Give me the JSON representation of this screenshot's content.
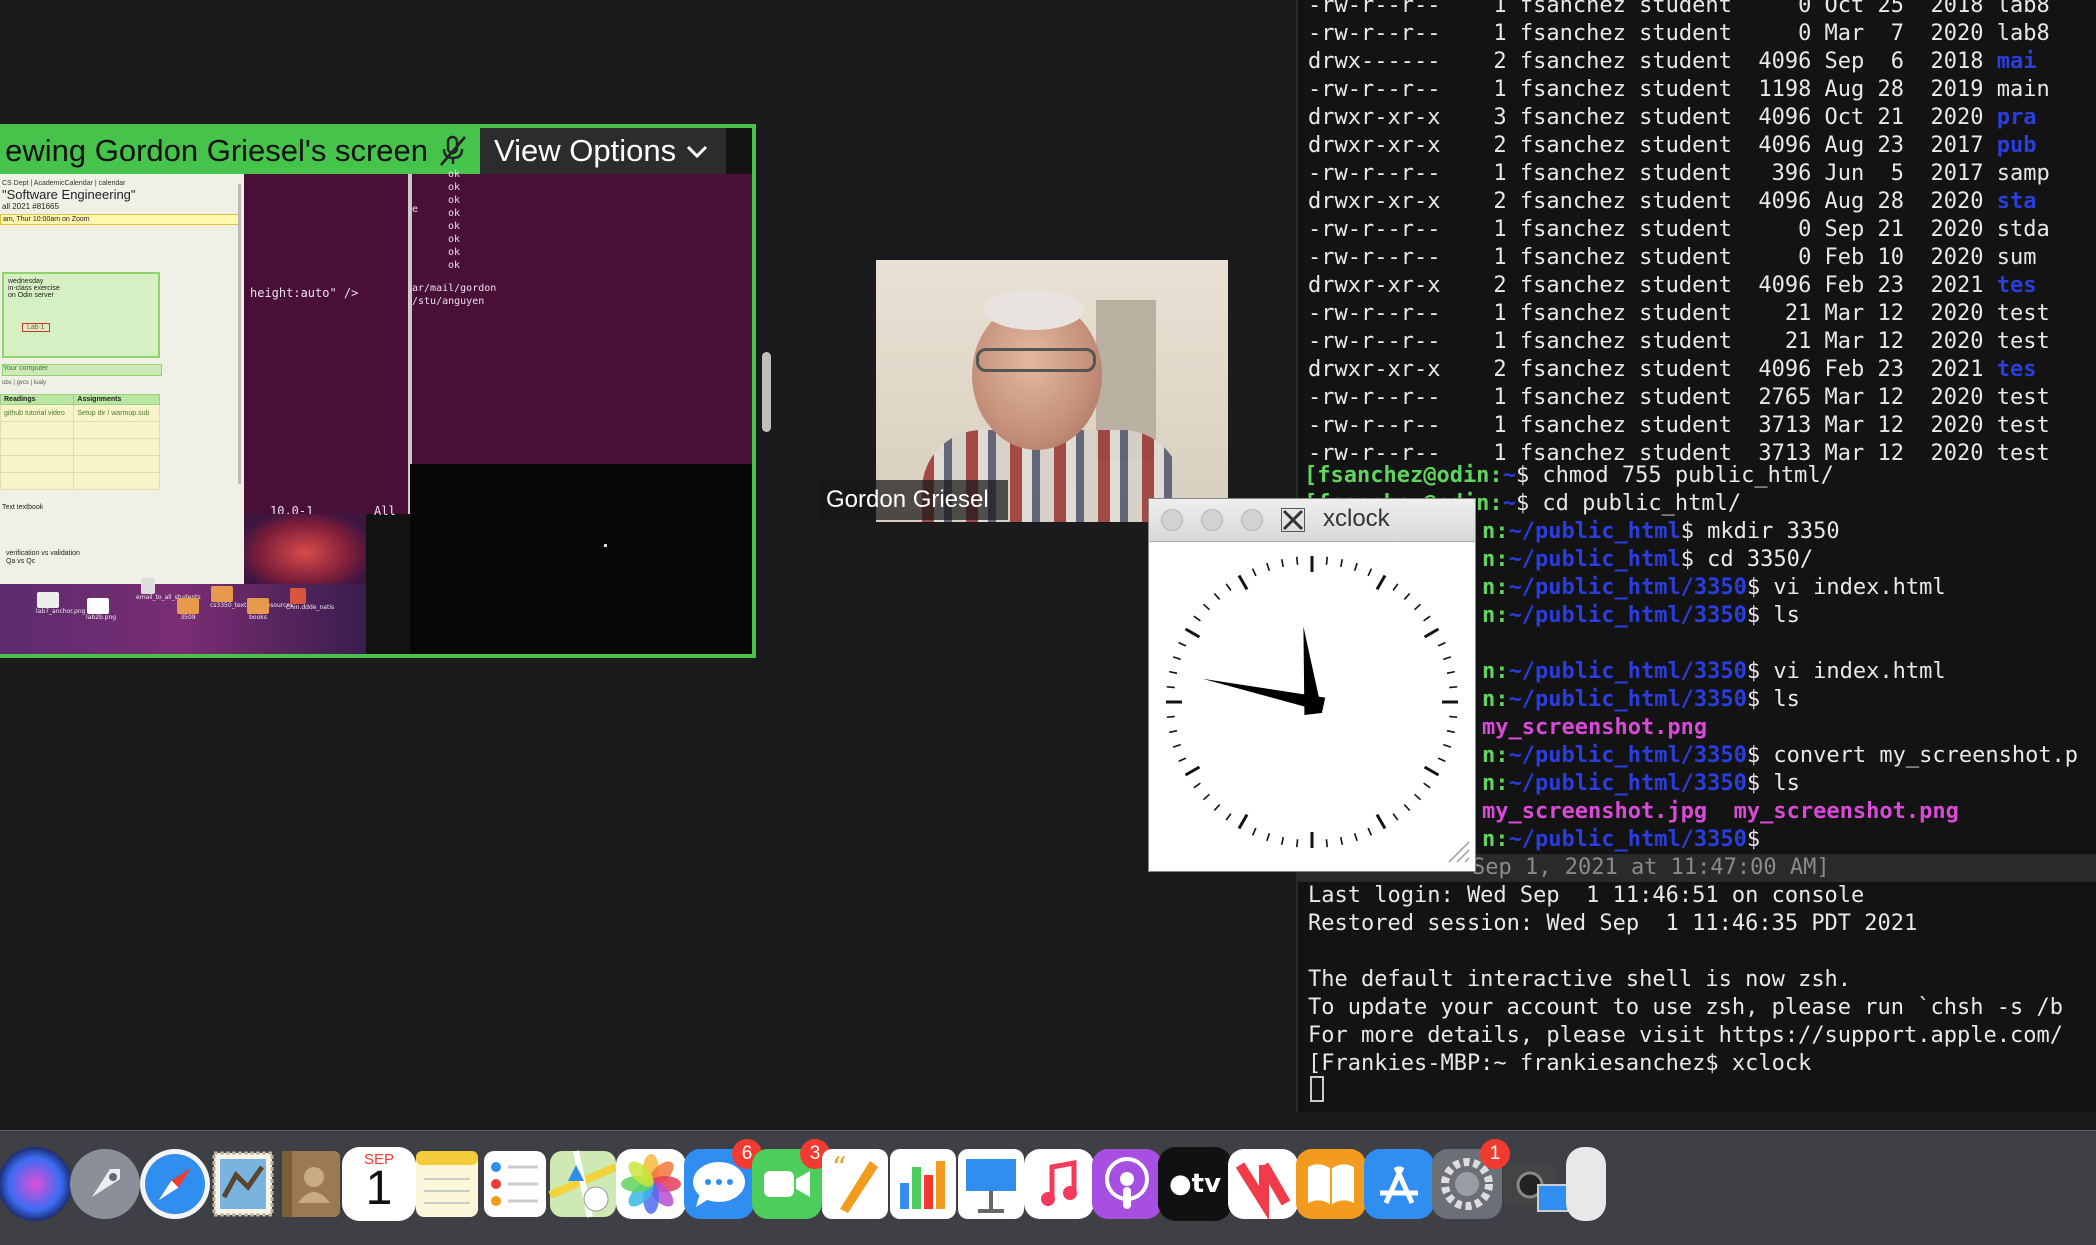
{
  "screen_share": {
    "banner_text": "ewing Gordon Griesel's screen",
    "view_options_label": "View Options",
    "content": {
      "browser": {
        "links": "CS Dept | AcademicCalendar | calendar",
        "course_title": "\"Software Engineering\"",
        "term": "all 2021  #81665",
        "schedule": "am, Thur 10:00am on Zoom",
        "day": "wednesday",
        "exercise": "in-class exercise",
        "server": "on Odin server",
        "lab": "Lab 1",
        "computer": "Your computer",
        "tools": "ubs | gvcs | lualy",
        "col_readings": "Readings",
        "col_assignments": "Assignments",
        "reading_1": "github tutorial video",
        "assignment_1": "Setup dir / warmup.sub",
        "textbook": "Text textbook",
        "verification": "verification vs validation",
        "qa": "Qa vs Qc"
      },
      "editor": {
        "code_line": "height:auto\" />",
        "oks": [
          "ok",
          "ok",
          "ok",
          "ok",
          "ok",
          "ok",
          "ok",
          "ok"
        ],
        "side_chars": [
          "e"
        ],
        "path_1": "ar/mail/gordon",
        "path_2": "/stu/anguyen",
        "status_pos": "10,0-1",
        "status_all": "All"
      },
      "desktop_icons": [
        "lab7_anchor.png",
        "lab2b.png",
        "email_to_all_students",
        "3509",
        "cs3350_textbook_resources",
        "books",
        "Chin.ddde_natis"
      ]
    }
  },
  "participant": {
    "name": "Gordon Griesel"
  },
  "xclock": {
    "title": "xclock",
    "time": "11:47"
  },
  "terminal": {
    "listing": [
      {
        "perm": "-rw-r--r--",
        "links": "1",
        "user": "fsanchez",
        "group": "student",
        "size": "0",
        "mon": "Oct",
        "day": "25",
        "year": "2018",
        "name": "lab8",
        "cls": "plain"
      },
      {
        "perm": "-rw-r--r--",
        "links": "1",
        "user": "fsanchez",
        "group": "student",
        "size": "0",
        "mon": "Mar",
        "day": "7",
        "year": "2020",
        "name": "lab8",
        "cls": "plain"
      },
      {
        "perm": "drwx------",
        "links": "2",
        "user": "fsanchez",
        "group": "student",
        "size": "4096",
        "mon": "Sep",
        "day": "6",
        "year": "2018",
        "name": "mai",
        "cls": "dir"
      },
      {
        "perm": "-rw-r--r--",
        "links": "1",
        "user": "fsanchez",
        "group": "student",
        "size": "1198",
        "mon": "Aug",
        "day": "28",
        "year": "2019",
        "name": "main",
        "cls": "plain"
      },
      {
        "perm": "drwxr-xr-x",
        "links": "3",
        "user": "fsanchez",
        "group": "student",
        "size": "4096",
        "mon": "Oct",
        "day": "21",
        "year": "2020",
        "name": "pra",
        "cls": "dir"
      },
      {
        "perm": "drwxr-xr-x",
        "links": "2",
        "user": "fsanchez",
        "group": "student",
        "size": "4096",
        "mon": "Aug",
        "day": "23",
        "year": "2017",
        "name": "pub",
        "cls": "dir"
      },
      {
        "perm": "-rw-r--r--",
        "links": "1",
        "user": "fsanchez",
        "group": "student",
        "size": "396",
        "mon": "Jun",
        "day": "5",
        "year": "2017",
        "name": "samp",
        "cls": "plain"
      },
      {
        "perm": "drwxr-xr-x",
        "links": "2",
        "user": "fsanchez",
        "group": "student",
        "size": "4096",
        "mon": "Aug",
        "day": "28",
        "year": "2020",
        "name": "sta",
        "cls": "dir"
      },
      {
        "perm": "-rw-r--r--",
        "links": "1",
        "user": "fsanchez",
        "group": "student",
        "size": "0",
        "mon": "Sep",
        "day": "21",
        "year": "2020",
        "name": "stda",
        "cls": "plain"
      },
      {
        "perm": "-rw-r--r--",
        "links": "1",
        "user": "fsanchez",
        "group": "student",
        "size": "0",
        "mon": "Feb",
        "day": "10",
        "year": "2020",
        "name": "sum",
        "cls": "plain"
      },
      {
        "perm": "drwxr-xr-x",
        "links": "2",
        "user": "fsanchez",
        "group": "student",
        "size": "4096",
        "mon": "Feb",
        "day": "23",
        "year": "2021",
        "name": "tes",
        "cls": "dir"
      },
      {
        "perm": "-rw-r--r--",
        "links": "1",
        "user": "fsanchez",
        "group": "student",
        "size": "21",
        "mon": "Mar",
        "day": "12",
        "year": "2020",
        "name": "test",
        "cls": "plain"
      },
      {
        "perm": "-rw-r--r--",
        "links": "1",
        "user": "fsanchez",
        "group": "student",
        "size": "21",
        "mon": "Mar",
        "day": "12",
        "year": "2020",
        "name": "test",
        "cls": "plain"
      },
      {
        "perm": "drwxr-xr-x",
        "links": "2",
        "user": "fsanchez",
        "group": "student",
        "size": "4096",
        "mon": "Feb",
        "day": "23",
        "year": "2021",
        "name": "tes",
        "cls": "dir"
      },
      {
        "perm": "-rw-r--r--",
        "links": "1",
        "user": "fsanchez",
        "group": "student",
        "size": "2765",
        "mon": "Mar",
        "day": "12",
        "year": "2020",
        "name": "test",
        "cls": "plain"
      },
      {
        "perm": "-rw-r--r--",
        "links": "1",
        "user": "fsanchez",
        "group": "student",
        "size": "3713",
        "mon": "Mar",
        "day": "12",
        "year": "2020",
        "name": "test",
        "cls": "plain"
      },
      {
        "perm": "-rw-r--r--",
        "links": "1",
        "user": "fsanchez",
        "group": "student",
        "size": "3713",
        "mon": "Mar",
        "day": "12",
        "year": "2020",
        "name": "test",
        "cls": "plain"
      }
    ],
    "prompt_user": "fsanchez@odin",
    "commands": [
      {
        "lead": "[fsanchez@odin:",
        "path": "~",
        "cmd": "$ chmod 755 public_html/"
      },
      {
        "lead": "[fsanchez@odin:",
        "path": "~",
        "cmd": "$ cd public_html/"
      },
      {
        "lead": "n:",
        "path": "~/public_html",
        "cmd": "$ mkdir 3350"
      },
      {
        "lead": "n:",
        "path": "~/public_html",
        "cmd": "$ cd 3350/"
      },
      {
        "lead": "n:",
        "path": "~/public_html/3350",
        "cmd": "$ vi index.html"
      },
      {
        "lead": "n:",
        "path": "~/public_html/3350",
        "cmd": "$ ls"
      },
      {
        "lead": "",
        "path": "",
        "cmd": ""
      },
      {
        "lead": "n:",
        "path": "~/public_html/3350",
        "cmd": "$ vi index.html"
      },
      {
        "lead": "n:",
        "path": "~/public_html/3350",
        "cmd": "$ ls"
      },
      {
        "lead": "",
        "path": "",
        "cmd": "",
        "file1": "my_screenshot.png"
      },
      {
        "lead": "n:",
        "path": "~/public_html/3350",
        "cmd": "$ convert my_screenshot.p"
      },
      {
        "lead": "n:",
        "path": "~/public_html/3350",
        "cmd": "$ ls"
      },
      {
        "lead": "",
        "path": "",
        "cmd": "",
        "file1": "my_screenshot.jpg",
        "file2": "my_screenshot.png"
      },
      {
        "lead": "n:",
        "path": "~/public_html/3350",
        "cmd": "$"
      }
    ],
    "restore_banner": "Sep 1, 2021 at 11:47:00 AM]",
    "last_login": "Last login: Wed Sep  1 11:46:51 on console",
    "restored": "Restored session: Wed Sep  1 11:46:35 PDT 2021",
    "zsh_1": "The default interactive shell is now zsh.",
    "zsh_2": "To update your account to use zsh, please run `chsh -s /b",
    "zsh_3": "For more details, please visit https://support.apple.com/",
    "mac_prompt": "[Frankies-MBP:~ frankiesanchez$ xclock"
  },
  "dock": {
    "calendar_month": "SEP",
    "calendar_day": "1",
    "messages_badge": "6",
    "facetime_badge": "3",
    "settings_badge": "1",
    "tv_label": "tv"
  },
  "colors": {
    "share_border": "#45c34a",
    "terminal_bg": "#131313",
    "prompt_green": "#5fd45f",
    "path_blue": "#2a3ee0",
    "file_magenta": "#d94ad9",
    "badge_red": "#f23b30"
  }
}
